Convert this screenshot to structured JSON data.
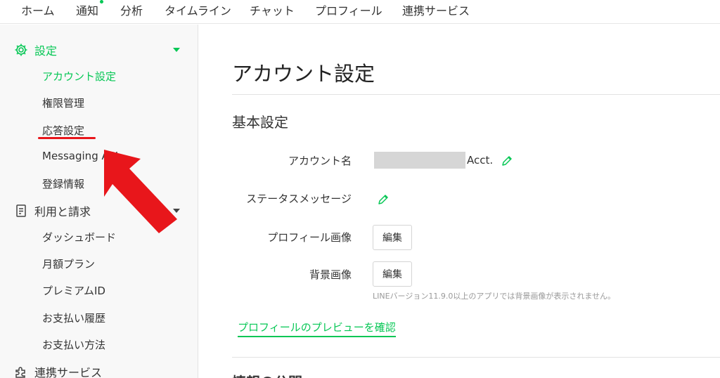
{
  "topnav": {
    "items": [
      "ホーム",
      "通知",
      "分析",
      "タイムライン",
      "チャット",
      "プロフィール",
      "連携サービス"
    ]
  },
  "sidebar": {
    "settings": {
      "label": "設定",
      "items": [
        "アカウント設定",
        "権限管理",
        "応答設定",
        "Messaging API",
        "登録情報"
      ]
    },
    "billing": {
      "label": "利用と請求",
      "items": [
        "ダッシュボード",
        "月額プラン",
        "プレミアムID",
        "お支払い履歴",
        "お支払い方法"
      ]
    },
    "integrations": {
      "label": "連携サービス"
    }
  },
  "main": {
    "title": "アカウント設定",
    "basic": {
      "title": "基本設定",
      "account_name_label": "アカウント名",
      "account_name_suffix": "Acct.",
      "status_label": "ステータスメッセージ",
      "profile_image_label": "プロフィール画像",
      "background_label": "背景画像",
      "edit_label": "編集",
      "note": "LINEバージョン11.9.0以上のアプリでは背景画像が表示されません。",
      "preview_link": "プロフィールのプレビューを確認"
    },
    "next_section_title": "情報の公開"
  },
  "colors": {
    "accent": "#06c755",
    "annotation": "#e8161b"
  },
  "icons": {
    "settings": "gear-icon",
    "billing": "document-icon",
    "integrations": "puzzle-icon",
    "edit": "pencil-icon"
  }
}
